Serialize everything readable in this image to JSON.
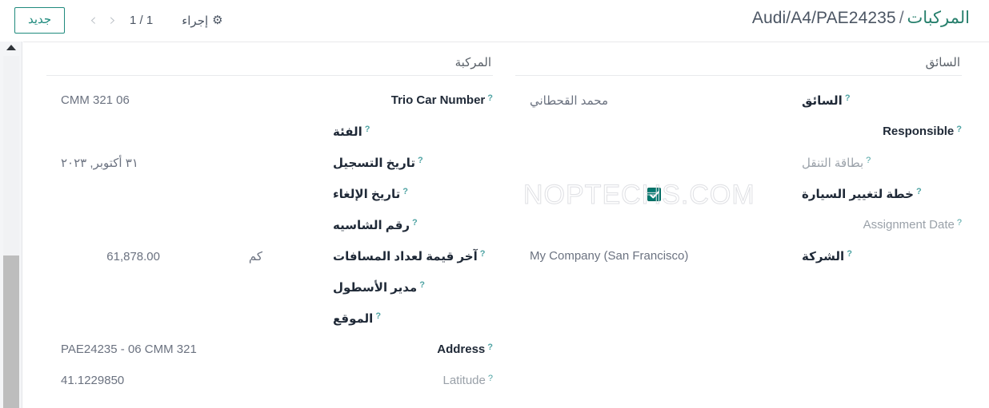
{
  "window": {
    "edge_strip_color": "#5f3a52",
    "accent_color": "#1f8a7d",
    "checkbox_color": "#02786f",
    "link_color": "#28806d"
  },
  "topbar": {
    "new_button": "جديد",
    "prev_arrow": "‹",
    "next_arrow": "›",
    "pager_count": "1 / 1",
    "action_label": "إجراء",
    "gear_icon": "⚙"
  },
  "breadcrumb": {
    "root": "المركبات",
    "separator": "/",
    "current": "Audi/A4/PAE24235"
  },
  "watermark": "NOPTECHS.COM",
  "form": {
    "left_column": {
      "group_title": "المركبة",
      "fields": [
        {
          "label": "Trio Car Number",
          "label_dir": "ltr",
          "help": "?",
          "value": "CMM 321 06",
          "value_dir": "ltr",
          "dim": false
        },
        {
          "label": "الفئة",
          "label_dir": "rtl",
          "help": "?",
          "value": "",
          "value_dir": "rtl",
          "dim": false
        },
        {
          "label": "تاريخ التسجيل",
          "label_dir": "rtl",
          "help": "?",
          "value": "٣١ أكتوبر, ٢٠٢٣",
          "value_dir": "rtl",
          "dim": false
        },
        {
          "label": "تاريخ الإلغاء",
          "label_dir": "rtl",
          "help": "?",
          "value": "",
          "value_dir": "rtl",
          "dim": false
        },
        {
          "label": "رقم الشاسيه",
          "label_dir": "rtl",
          "help": "?",
          "value": "",
          "value_dir": "rtl",
          "dim": false
        },
        {
          "label": "آخر قيمة لعداد المسافات",
          "label_dir": "rtl",
          "help": "?",
          "value": "61,878.00",
          "unit": "كم",
          "value_dir": "ltr",
          "dim": false
        },
        {
          "label": "مدير الأسطول",
          "label_dir": "rtl",
          "help": "?",
          "value": "",
          "value_dir": "rtl",
          "dim": false
        },
        {
          "label": "الموقع",
          "label_dir": "rtl",
          "help": "?",
          "value": "",
          "value_dir": "rtl",
          "dim": false
        },
        {
          "label": "Address",
          "label_dir": "ltr",
          "help": "?",
          "value": "PAE24235 - 06 CMM 321",
          "value_dir": "ltr",
          "dim": false
        },
        {
          "label": "Latitude",
          "label_dir": "ltr",
          "help": "?",
          "value": "41.1229850",
          "value_dir": "ltr",
          "dim": true
        }
      ]
    },
    "right_column": {
      "group_title": "السائق",
      "fields": [
        {
          "label": "السائق",
          "label_dir": "rtl",
          "help": "?",
          "value": "محمد القحطاني",
          "value_dir": "rtl",
          "dim": false
        },
        {
          "label": "Responsible",
          "label_dir": "ltr",
          "help": "?",
          "value": "",
          "value_dir": "ltr",
          "dim": false
        },
        {
          "label": "بطاقة التنقل",
          "label_dir": "rtl",
          "help": "?",
          "value": "",
          "value_dir": "rtl",
          "dim": true
        },
        {
          "label": "خطة لتغيير السيارة",
          "label_dir": "rtl",
          "help": "?",
          "value": "",
          "value_dir": "rtl",
          "dim": false,
          "checkbox": true,
          "checked": true
        },
        {
          "label": "Assignment Date",
          "label_dir": "ltr",
          "help": "?",
          "value": "",
          "value_dir": "ltr",
          "dim": true
        },
        {
          "label": "الشركة",
          "label_dir": "rtl",
          "help": "?",
          "value": "My Company (San Francisco)",
          "value_dir": "ltr",
          "dim": false
        }
      ]
    }
  }
}
